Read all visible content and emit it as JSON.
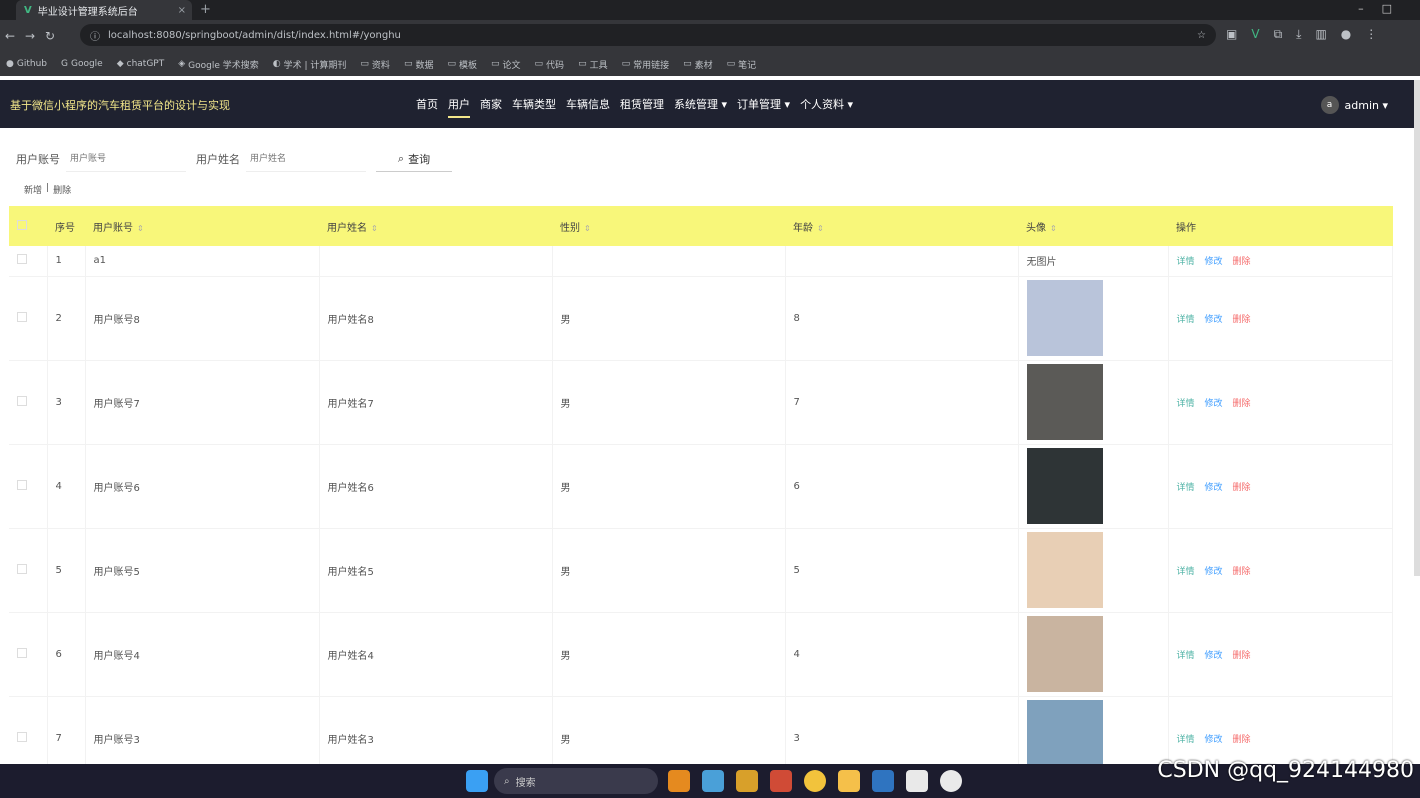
{
  "browser": {
    "tab_title": "毕业设计管理系统后台",
    "new_tab": "+",
    "url": "localhost:8080/springboot/admin/dist/index.html#/yonghu",
    "bookmarks": [
      "Github",
      "Google",
      "chatGPT",
      "Google 学术搜索",
      "学术 | 计算期刊",
      "资料",
      "数据",
      "模板",
      "论文",
      "代码",
      "工具",
      "常用链接",
      "素材",
      "笔记"
    ]
  },
  "app": {
    "title": "基于微信小程序的汽车租赁平台的设计与实现",
    "menu": [
      "首页",
      "用户",
      "商家",
      "车辆类型",
      "车辆信息",
      "租赁管理",
      "系统管理 ▾",
      "订单管理 ▾",
      "个人资料 ▾"
    ],
    "active_menu": "用户",
    "user": {
      "avatar_text": "a",
      "name": "admin ▾"
    }
  },
  "search": {
    "account_label": "用户账号",
    "account_placeholder": "用户账号",
    "name_label": "用户姓名",
    "name_placeholder": "用户姓名",
    "button_label": "查询",
    "search_icon": "search-icon"
  },
  "toolbar": {
    "add_label": "新增",
    "sep": "|",
    "delete_label": "删除"
  },
  "table": {
    "headers": [
      "序号",
      "用户账号",
      "用户姓名",
      "性别",
      "年龄",
      "头像",
      "操作"
    ],
    "ops": {
      "view": "详情",
      "edit": "修改",
      "delete": "删除"
    },
    "rows": [
      {
        "index": "1",
        "account": "a1",
        "name": "",
        "gender": "",
        "age": "",
        "avatar": "无图片",
        "photo_color": ""
      },
      {
        "index": "2",
        "account": "用户账号8",
        "name": "用户姓名8",
        "gender": "男",
        "age": "8",
        "avatar": "",
        "photo_color": "#b9c4da"
      },
      {
        "index": "3",
        "account": "用户账号7",
        "name": "用户姓名7",
        "gender": "男",
        "age": "7",
        "avatar": "",
        "photo_color": "#5b5a57"
      },
      {
        "index": "4",
        "account": "用户账号6",
        "name": "用户姓名6",
        "gender": "男",
        "age": "6",
        "avatar": "",
        "photo_color": "#2e3436"
      },
      {
        "index": "5",
        "account": "用户账号5",
        "name": "用户姓名5",
        "gender": "男",
        "age": "5",
        "avatar": "",
        "photo_color": "#e8cfb5"
      },
      {
        "index": "6",
        "account": "用户账号4",
        "name": "用户姓名4",
        "gender": "男",
        "age": "4",
        "avatar": "",
        "photo_color": "#c9b4a0"
      },
      {
        "index": "7",
        "account": "用户账号3",
        "name": "用户姓名3",
        "gender": "男",
        "age": "3",
        "avatar": "",
        "photo_color": "#7fa1bd"
      }
    ]
  },
  "taskbar": {
    "search_label": "搜索"
  },
  "watermark": "CSDN @qq_924144980"
}
